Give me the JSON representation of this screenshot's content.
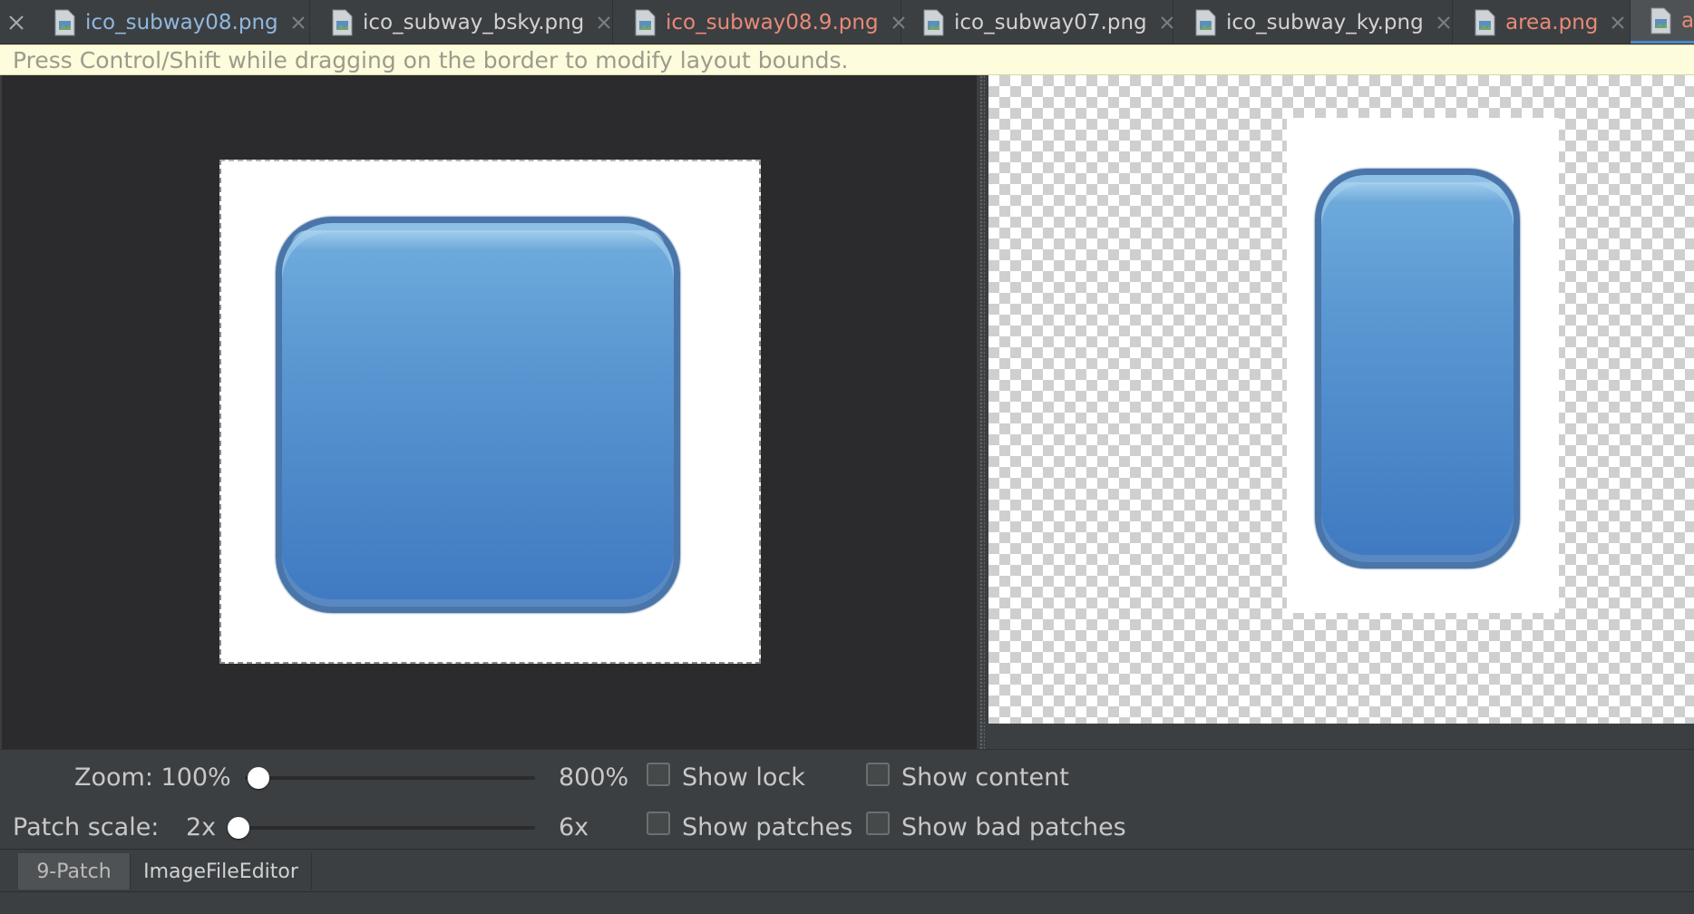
{
  "tabs": [
    {
      "label": "ico_subway08.png",
      "color": "#8fb8e0",
      "state": "normal"
    },
    {
      "label": "ico_subway_bsky.png",
      "color": "#d2d2d2",
      "state": "normal"
    },
    {
      "label": "ico_subway08.9.png",
      "color": "#e88a78",
      "state": "modified"
    },
    {
      "label": "ico_subway07.png",
      "color": "#d2d2d2",
      "state": "normal"
    },
    {
      "label": "ico_subway_ky.png",
      "color": "#d2d2d2",
      "state": "normal"
    },
    {
      "label": "area.png",
      "color": "#e88a78",
      "state": "modified"
    },
    {
      "label": "a",
      "color": "#e88a78",
      "state": "active-truncated"
    }
  ],
  "infobar": {
    "message": "Press Control/Shift while dragging on the border to modify layout bounds."
  },
  "controls": {
    "zoom": {
      "label": "Zoom: 100%",
      "max_label": "800%",
      "value_fraction": 0.0
    },
    "patch_scale": {
      "label": "Patch scale:",
      "value_label": "2x",
      "max_label": "6x",
      "value_fraction": 0.0
    },
    "checkboxes": {
      "show_lock": {
        "label": "Show lock",
        "checked": false
      },
      "show_content": {
        "label": "Show content",
        "checked": false
      },
      "show_patches": {
        "label": "Show patches",
        "checked": false
      },
      "show_bad_patches": {
        "label": "Show bad patches",
        "checked": false
      }
    }
  },
  "bottom_tabs": [
    {
      "label": "9-Patch",
      "selected": true
    },
    {
      "label": "ImageFileEditor",
      "selected": false
    }
  ],
  "colors": {
    "accent": "#4a88c7",
    "modified_tab": "#e88a78",
    "button_fill": "#5b98d2",
    "button_border": "#4a75a9"
  }
}
